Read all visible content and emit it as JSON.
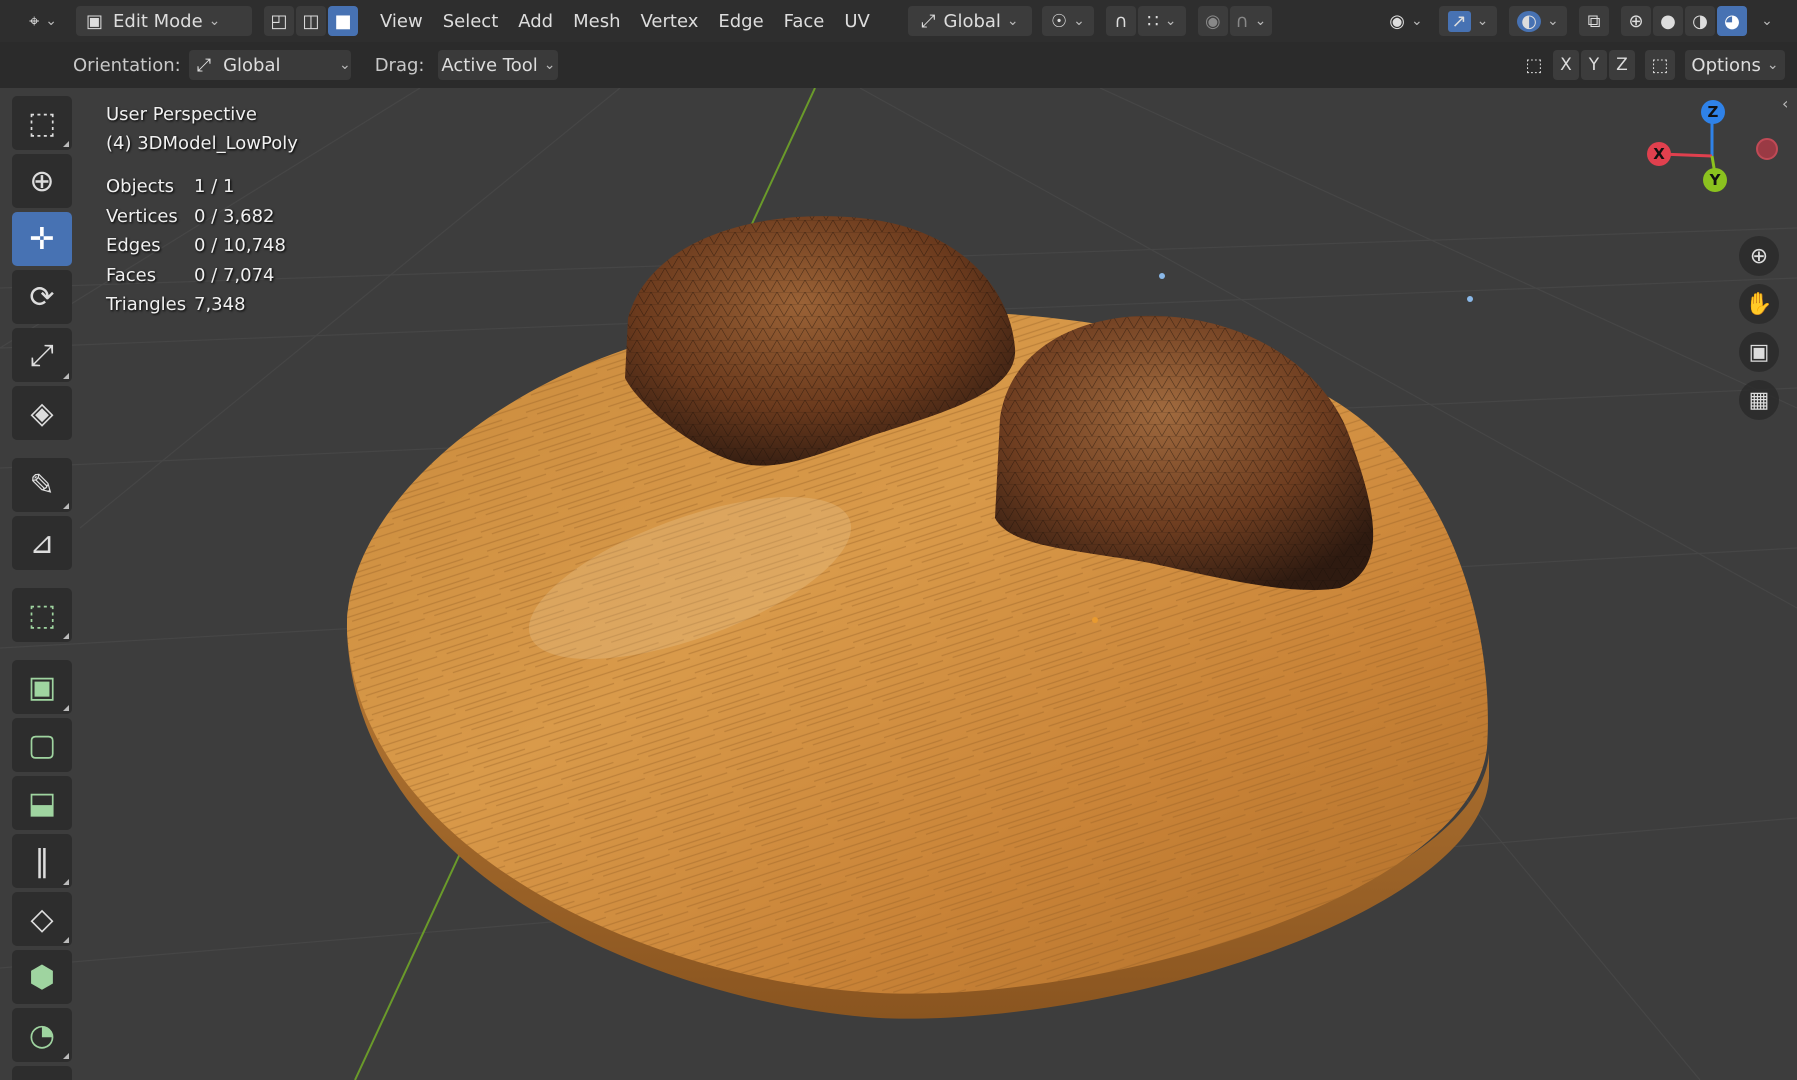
{
  "header": {
    "editor_type_icon": "editor-type-icon",
    "mode": "Edit Mode",
    "menus": [
      "View",
      "Select",
      "Add",
      "Mesh",
      "Vertex",
      "Edge",
      "Face",
      "UV"
    ],
    "transform_orientation": "Global"
  },
  "subheader": {
    "orientation_label": "Orientation:",
    "orientation_value": "Global",
    "drag_label": "Drag:",
    "drag_value": "Active Tool",
    "axis_x": "X",
    "axis_y": "Y",
    "axis_z": "Z",
    "options": "Options"
  },
  "viewport": {
    "view_name": "User Perspective",
    "object_name": "(4) 3DModel_LowPoly",
    "stats": [
      {
        "key": "Objects",
        "value": "1 / 1"
      },
      {
        "key": "Vertices",
        "value": "0 / 3,682"
      },
      {
        "key": "Edges",
        "value": "0 / 10,748"
      },
      {
        "key": "Faces",
        "value": "0 / 7,074"
      },
      {
        "key": "Triangles",
        "value": "7,348"
      }
    ],
    "gizmo": {
      "x": "X",
      "y": "Y",
      "z": "Z"
    }
  },
  "colors": {
    "accent": "#4772b3",
    "axis_x": "#e0404e",
    "axis_y": "#8bc21f",
    "axis_z": "#2f82e8"
  }
}
